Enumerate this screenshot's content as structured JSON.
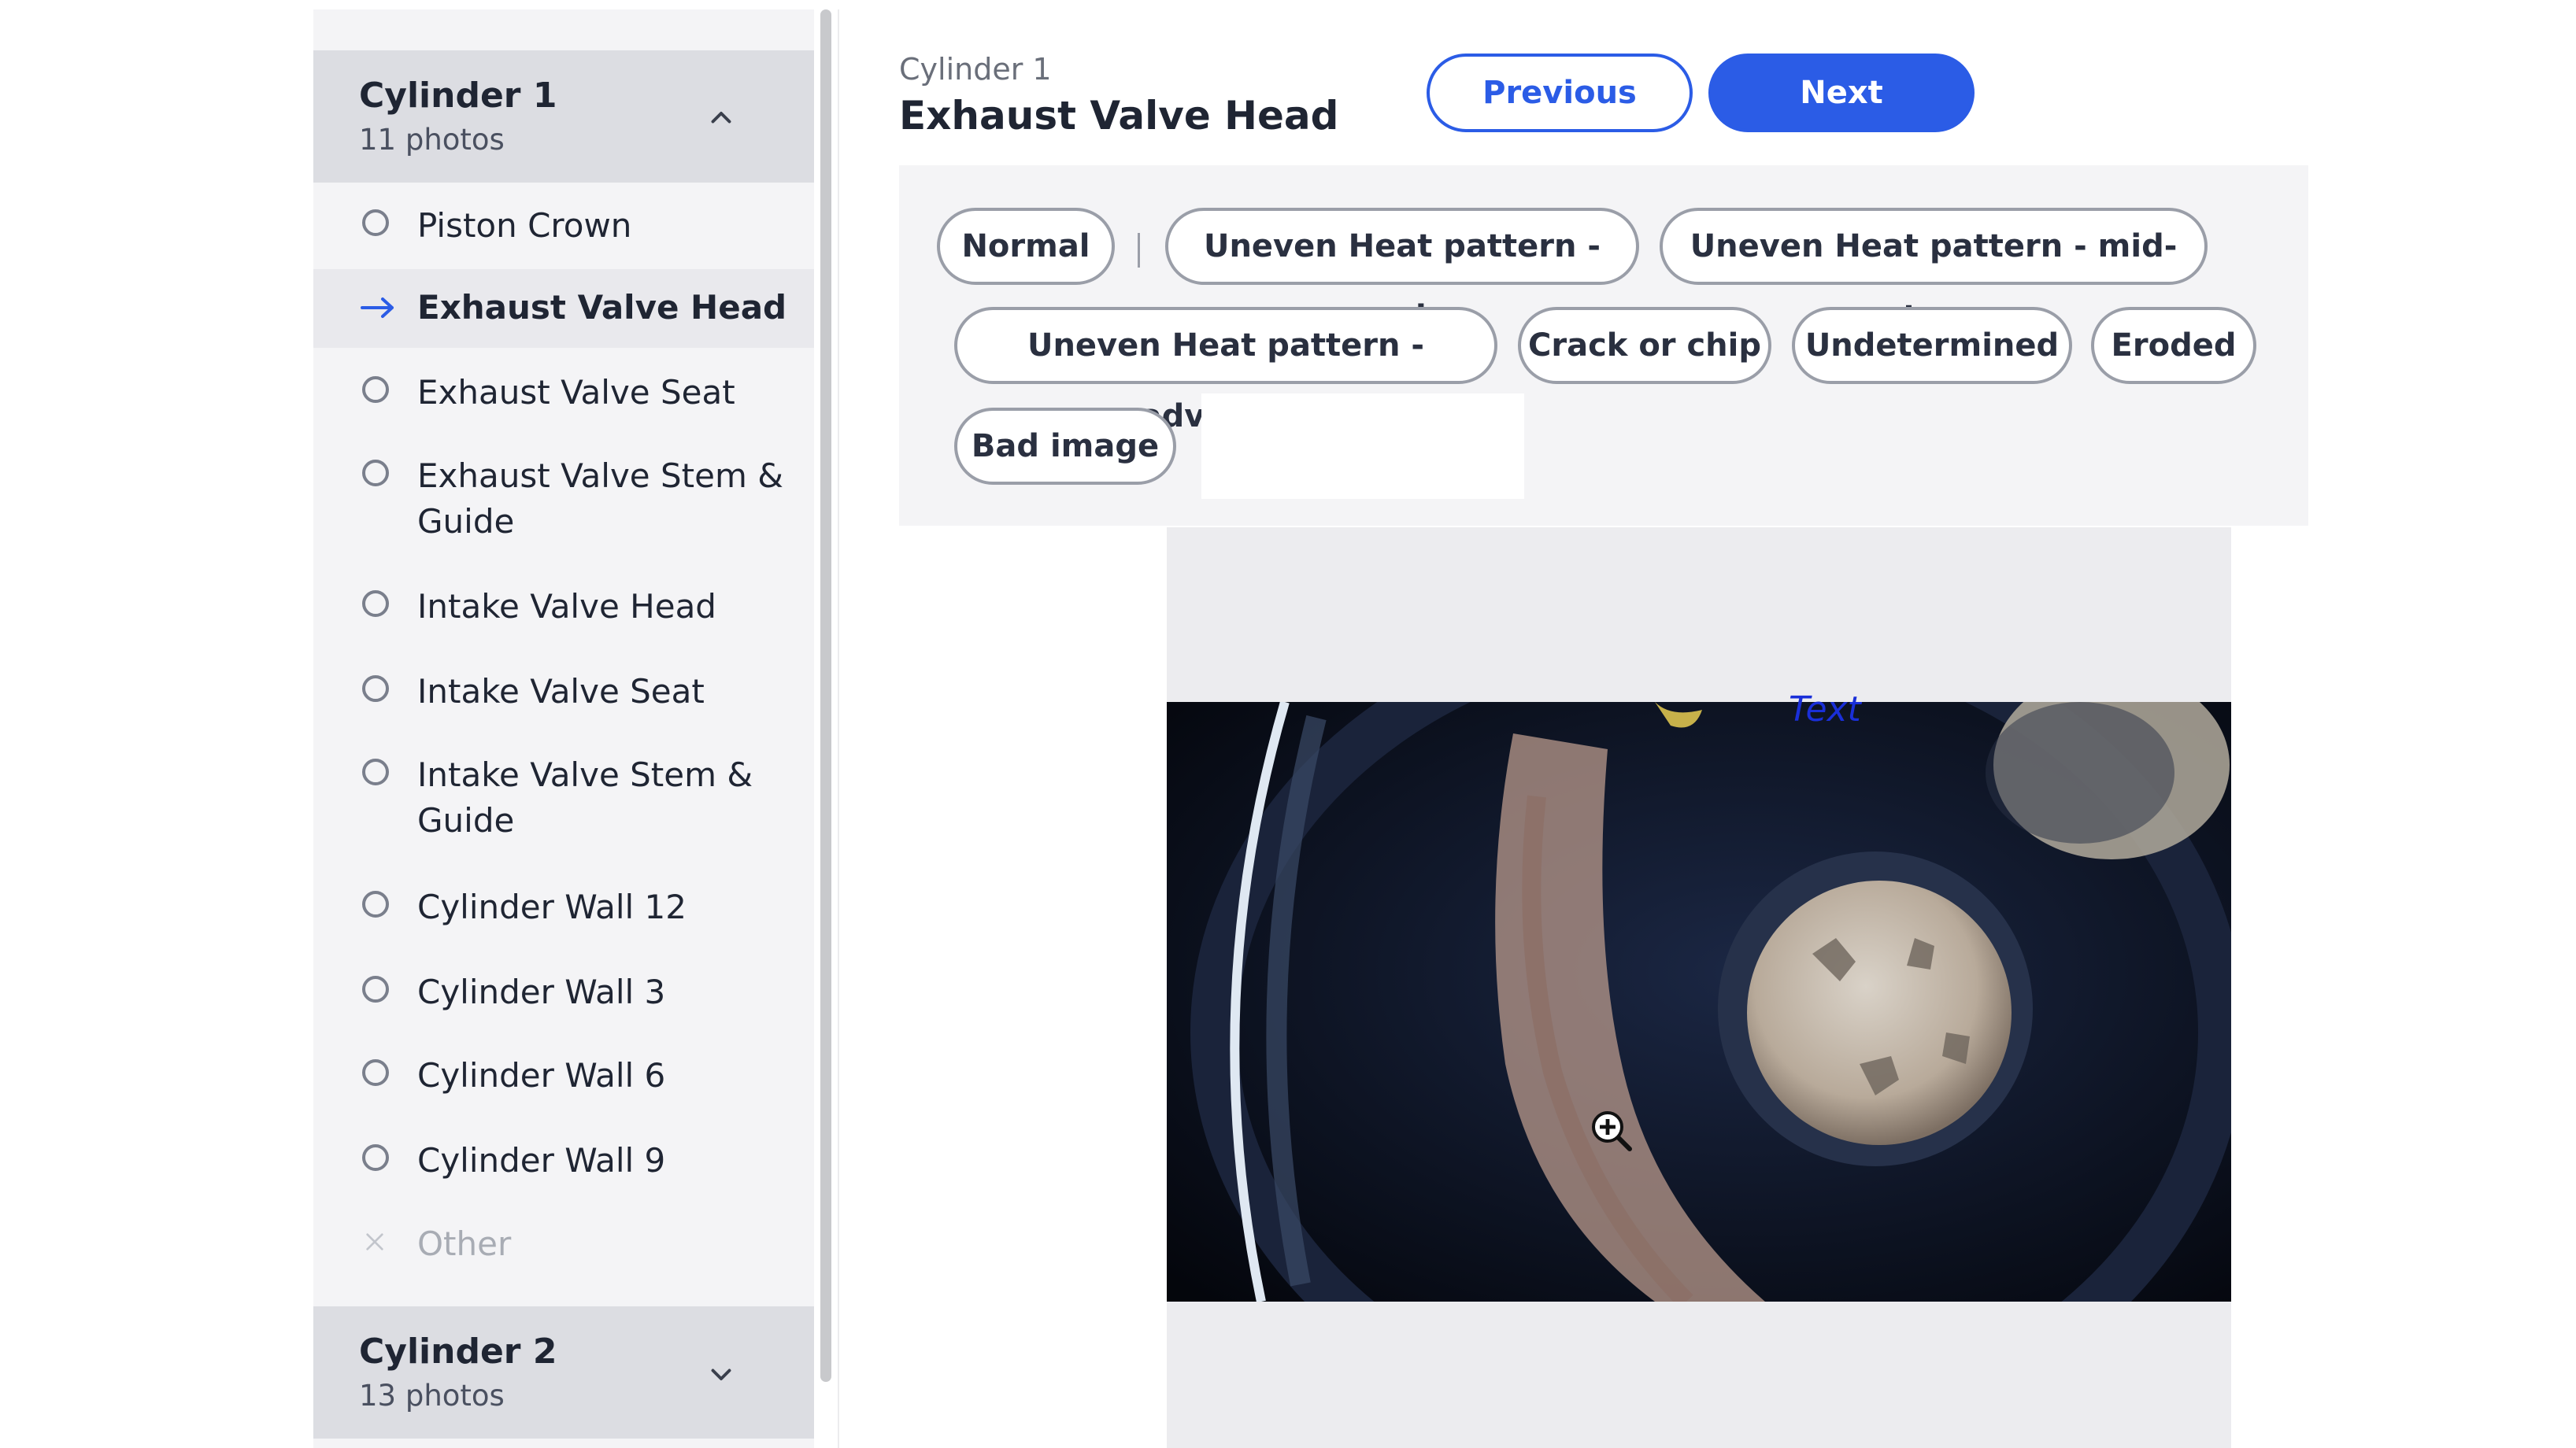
{
  "sidebar": {
    "cylinders": [
      {
        "title": "Cylinder 1",
        "subtitle": "11 photos",
        "expanded": true,
        "items": [
          {
            "label": "Piston Crown",
            "state": "pending"
          },
          {
            "label": "Exhaust Valve Head",
            "state": "current"
          },
          {
            "label": "Exhaust Valve Seat",
            "state": "pending"
          },
          {
            "label": "Exhaust Valve Stem & Guide",
            "state": "pending"
          },
          {
            "label": "Intake Valve Head",
            "state": "pending"
          },
          {
            "label": "Intake Valve Seat",
            "state": "pending"
          },
          {
            "label": "Intake Valve Stem & Guide",
            "state": "pending"
          },
          {
            "label": "Cylinder Wall 12",
            "state": "pending"
          },
          {
            "label": "Cylinder Wall 3",
            "state": "pending"
          },
          {
            "label": "Cylinder Wall 6",
            "state": "pending"
          },
          {
            "label": "Cylinder Wall 9",
            "state": "pending"
          },
          {
            "label": "Other",
            "state": "disabled"
          }
        ]
      },
      {
        "title": "Cylinder 2",
        "subtitle": "13 photos",
        "expanded": false
      }
    ]
  },
  "header": {
    "breadcrumb": "Cylinder 1",
    "title": "Exhaust Valve Head",
    "previous_label": "Previous",
    "next_label": "Next"
  },
  "tags": {
    "normal": "Normal",
    "options": [
      "Uneven Heat pattern - early",
      "Uneven Heat pattern - mid-stage",
      "Uneven Heat pattern - advanced",
      "Crack or chip",
      "Undetermined",
      "Eroded",
      "Bad image"
    ]
  },
  "viewer": {
    "overlay_text": "Text"
  },
  "colors": {
    "accent": "#2b5ce6",
    "sidebar_bg": "#f4f4f6",
    "header_bg": "#dcdde2"
  },
  "icons": {
    "collapse": "chevron-up-icon",
    "expand": "chevron-down-icon",
    "current": "arrow-right-icon",
    "pending": "circle-icon",
    "disabled": "x-icon",
    "zoom": "zoom-in-icon"
  }
}
